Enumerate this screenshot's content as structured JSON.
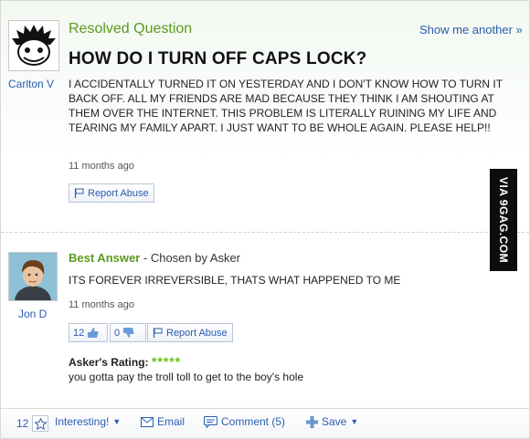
{
  "question": {
    "status": "Resolved Question",
    "show_another": "Show me another »",
    "title": "HOW DO I TURN OFF CAPS LOCK?",
    "body": "I ACCIDENTALLY TURNED IT ON YESTERDAY AND I DON'T KNOW HOW TO TURN IT BACK OFF. ALL MY FRIENDS ARE MAD BECAUSE THEY THINK I AM SHOUTING AT THEM OVER THE INTERNET. THIS PROBLEM IS LITERALLY RUINING MY LIFE AND TEARING MY FAMILY APART. I JUST WANT TO BE WHOLE AGAIN. PLEASE HELP!!",
    "timestamp": "11 months ago",
    "report_label": "Report Abuse",
    "asker_name": "Carlton V"
  },
  "answer": {
    "best_label": "Best Answer",
    "chosen_by": " - Chosen by Asker",
    "body": "ITS FOREVER IRREVERSIBLE, THATS WHAT HAPPENED TO ME",
    "timestamp": "11 months ago",
    "thumbs_up_count": "12",
    "thumbs_down_count": "0",
    "report_label": "Report Abuse",
    "answerer_name": "Jon D",
    "rating_label": "Asker's Rating:",
    "rating_stars": "*****",
    "rating_comment": "you gotta pay the troll toll to get to the boy's hole"
  },
  "toolbar": {
    "count": "12",
    "interesting_label": "Interesting!",
    "email_label": "Email",
    "comment_label": "Comment (5)",
    "save_label": "Save"
  },
  "watermark": {
    "text": "VIA 9GAG.COM"
  },
  "colors": {
    "accent_green": "#5b9a1f",
    "link_blue": "#2a5db0",
    "star_green": "#6bbf16"
  }
}
